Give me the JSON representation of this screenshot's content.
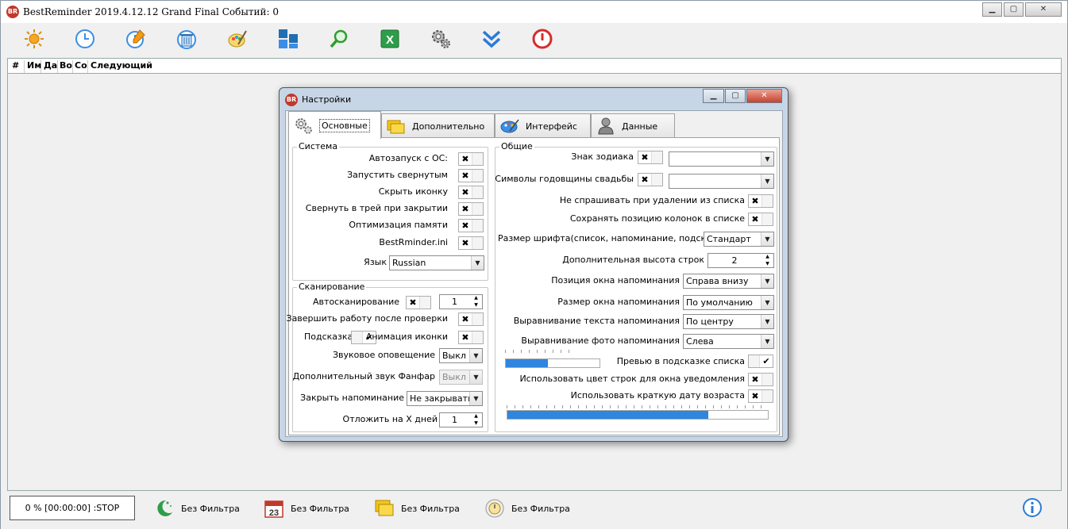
{
  "app": {
    "title": "BestReminder 2019.4.12.12 Grand Final   Событий:  0",
    "logo_text": "BR"
  },
  "window_controls": {
    "minimize": "▁",
    "maximize": "▢",
    "close": "✕"
  },
  "toolbar": {
    "items": [
      {
        "name": "sun-icon"
      },
      {
        "name": "clock-icon"
      },
      {
        "name": "clock-edit-icon"
      },
      {
        "name": "delete-icon"
      },
      {
        "name": "palette-icon"
      },
      {
        "name": "grid-icon"
      },
      {
        "name": "search-icon"
      },
      {
        "name": "excel-icon"
      },
      {
        "name": "settings-icon"
      },
      {
        "name": "double-chevron-down-icon"
      },
      {
        "name": "power-icon"
      }
    ]
  },
  "list": {
    "columns": [
      "#",
      "Им",
      "Да",
      "Во",
      "Со",
      "Следующий"
    ]
  },
  "status": {
    "progress_text": "0 % [00:00:00] :STOP",
    "filters": [
      "Без Фильтра",
      "Без Фильтра",
      "Без Фильтра",
      "Без Фильтра"
    ]
  },
  "dialog": {
    "title": "Настройки",
    "controls": {
      "minimize": "▁",
      "maximize": "▢",
      "close": "✕"
    },
    "tabs": [
      {
        "label": "Основные",
        "active": true
      },
      {
        "label": "Дополнительно",
        "active": false
      },
      {
        "label": "Интерфейс",
        "active": false
      },
      {
        "label": "Данные",
        "active": false
      }
    ],
    "system": {
      "legend": "Система",
      "rows": [
        {
          "label": "Автозапуск с ОС:",
          "mark": "✖"
        },
        {
          "label": "Запустить свернутым",
          "mark": "✖"
        },
        {
          "label": "Скрыть иконку",
          "mark": "✖"
        },
        {
          "label": "Свернуть в трей при закрытии",
          "mark": "✖"
        },
        {
          "label": "Оптимизация памяти",
          "mark": "✖"
        },
        {
          "label": "BestRminder.ini",
          "mark": "✖"
        }
      ],
      "language_label": "Язык",
      "language_value": "Russian"
    },
    "scan": {
      "legend": "Сканирование",
      "autoscan_label": "Автосканирование",
      "autoscan_mark": "✖",
      "autoscan_value": "1",
      "finish_label": "Завершить работу после проверки",
      "finish_mark": "✖",
      "hint_label": "Подсказка",
      "hint_mark": "✔",
      "anim_label": "Анимация иконки",
      "anim_mark": "✖",
      "sound_label": "Звуковое оповещение",
      "sound_value": "Выкл",
      "fanfare_label": "Дополнительный звук Фанфар",
      "fanfare_value": "Выкл",
      "close_label": "Закрыть напоминание",
      "close_value": "Не закрывать",
      "postpone_label": "Отложить на Х дней",
      "postpone_value": "1"
    },
    "general": {
      "legend": "Общие",
      "zodiac_label": "Знак зодиака",
      "zodiac_mark": "✖",
      "zodiac_value": "",
      "wedding_label": "Символы годовщины свадьбы",
      "wedding_mark": "✖",
      "wedding_value": "",
      "noask_label": "Не спрашивать при удалении из списка",
      "noask_mark": "✖",
      "savecols_label": "Сохранять позицию колонок в списке",
      "savecols_mark": "✖",
      "fontsize_label": "Размер шрифта(список, напоминание, подсказки)",
      "fontsize_value": "Стандарт",
      "rowheight_label": "Дополнительная высота строк",
      "rowheight_value": "2",
      "winpos_label": "Позиция окна напоминания",
      "winpos_value": "Справа внизу",
      "winsize_label": "Размер окна напоминания",
      "winsize_value": "По умолчанию",
      "textalign_label": "Выравнивание текста напоминания",
      "textalign_value": "По центру",
      "photoalign_label": "Выравнивание фото напоминания",
      "photoalign_value": "Слева",
      "preview_label": "Превью в подсказке списка",
      "preview_mark": "✔",
      "rowcolor_label": "Использовать цвет строк для окна уведомления",
      "rowcolor_mark": "✖",
      "shortdate_label": "Использовать краткую дату возраста",
      "shortdate_mark": "✖",
      "slider1_fraction": 0.45,
      "slider2_fraction": 0.77
    }
  },
  "colors": {
    "accent": "#2e86de",
    "dialog_frame": "#c7d6e6",
    "logo": "#c0392b"
  }
}
